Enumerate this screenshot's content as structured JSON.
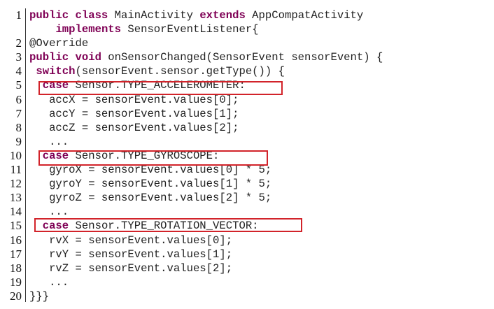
{
  "colors": {
    "keyword": "#7f0055",
    "text": "#222222",
    "highlight_box": "#d2232a",
    "background": "#ffffff"
  },
  "lines": [
    {
      "number": "1",
      "tokens": [
        {
          "t": "public class",
          "k": true
        },
        {
          "t": " MainActivity "
        },
        {
          "t": "extends",
          "k": true
        },
        {
          "t": " AppCompatActivity"
        }
      ]
    },
    {
      "number": "",
      "tokens": [
        {
          "t": "    "
        },
        {
          "t": "implements",
          "k": true
        },
        {
          "t": " SensorEventListener{"
        }
      ]
    },
    {
      "number": "2",
      "tokens": [
        {
          "t": "@Override"
        }
      ]
    },
    {
      "number": "3",
      "tokens": [
        {
          "t": "public void",
          "k": true
        },
        {
          "t": " onSensorChanged(SensorEvent sensorEvent) {"
        }
      ]
    },
    {
      "number": "4",
      "tokens": [
        {
          "t": " "
        },
        {
          "t": "switch",
          "k": true
        },
        {
          "t": "(sensorEvent.sensor.getType()) {"
        }
      ]
    },
    {
      "number": "5",
      "tokens": [
        {
          "t": "  "
        },
        {
          "t": "case",
          "k": true
        },
        {
          "t": " Sensor.TYPE_ACCELEROMETER:"
        }
      ]
    },
    {
      "number": "6",
      "tokens": [
        {
          "t": "   accX = sensorEvent.values[0];"
        }
      ]
    },
    {
      "number": "7",
      "tokens": [
        {
          "t": "   accY = sensorEvent.values[1];"
        }
      ]
    },
    {
      "number": "8",
      "tokens": [
        {
          "t": "   accZ = sensorEvent.values[2];"
        }
      ]
    },
    {
      "number": "9",
      "tokens": [
        {
          "t": "   ..."
        }
      ]
    },
    {
      "number": "10",
      "tokens": [
        {
          "t": "  "
        },
        {
          "t": "case",
          "k": true
        },
        {
          "t": " Sensor.TYPE_GYROSCOPE:"
        }
      ]
    },
    {
      "number": "11",
      "tokens": [
        {
          "t": "   gyroX = sensorEvent.values[0] * 5;"
        }
      ]
    },
    {
      "number": "12",
      "tokens": [
        {
          "t": "   gyroY = sensorEvent.values[1] * 5;"
        }
      ]
    },
    {
      "number": "13",
      "tokens": [
        {
          "t": "   gyroZ = sensorEvent.values[2] * 5;"
        }
      ]
    },
    {
      "number": "14",
      "tokens": [
        {
          "t": "   ..."
        }
      ]
    },
    {
      "number": "15",
      "tokens": [
        {
          "t": "  "
        },
        {
          "t": "case",
          "k": true
        },
        {
          "t": " Sensor.TYPE_ROTATION_VECTOR:"
        }
      ]
    },
    {
      "number": "16",
      "tokens": [
        {
          "t": "   rvX = sensorEvent.values[0];"
        }
      ]
    },
    {
      "number": "17",
      "tokens": [
        {
          "t": "   rvY = sensorEvent.values[1];"
        }
      ]
    },
    {
      "number": "18",
      "tokens": [
        {
          "t": "   rvZ = sensorEvent.values[2];"
        }
      ]
    },
    {
      "number": "19",
      "tokens": [
        {
          "t": "   ..."
        }
      ]
    },
    {
      "number": "20",
      "tokens": [
        {
          "t": "}}}"
        }
      ]
    }
  ]
}
